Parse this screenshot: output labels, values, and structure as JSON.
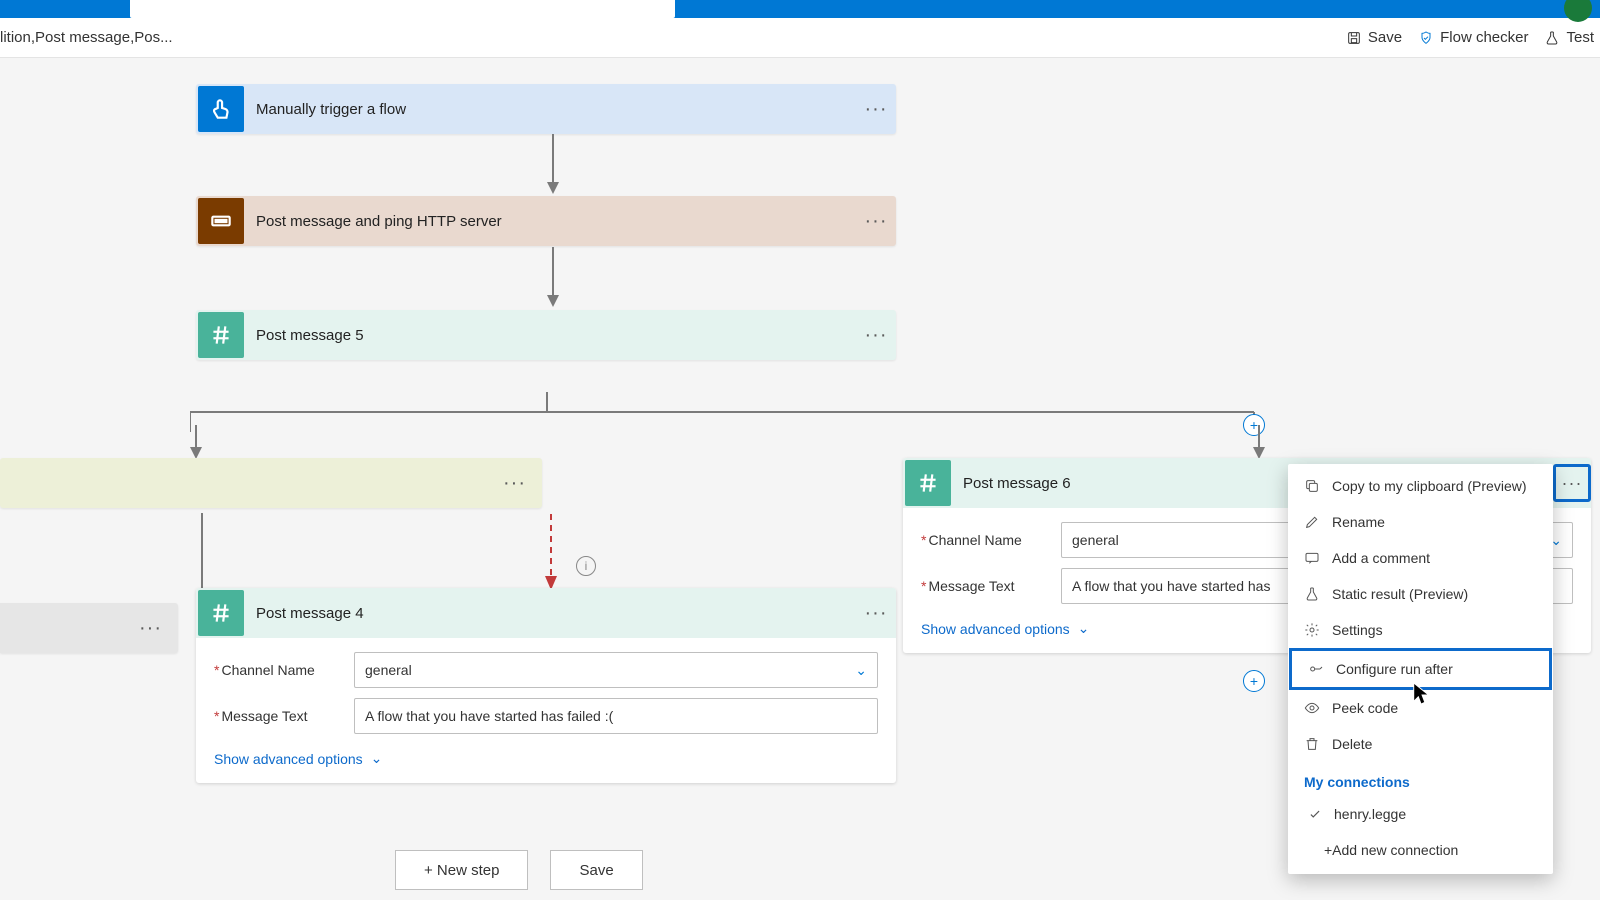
{
  "breadcrumb": "lition,Post message,Pos...",
  "toolbar": {
    "save": "Save",
    "flow_checker": "Flow checker",
    "test": "Test"
  },
  "steps": {
    "trigger": "Manually trigger a flow",
    "scope": "Post message and ping HTTP server",
    "slack5": "Post message 5",
    "pm4": {
      "title": "Post message 4",
      "channel_label": "Channel Name",
      "channel_value": "general",
      "msg_label": "Message Text",
      "msg_value": "A flow that you have started has failed :(",
      "advanced": "Show advanced options"
    },
    "pm6": {
      "title": "Post message 6",
      "channel_label": "Channel Name",
      "channel_value": "general",
      "msg_label": "Message Text",
      "msg_value": "A flow that you have started has",
      "advanced": "Show advanced options"
    }
  },
  "buttons": {
    "new_step": "+ New step",
    "save": "Save"
  },
  "menu": {
    "copy": "Copy to my clipboard (Preview)",
    "rename": "Rename",
    "comment": "Add a comment",
    "static": "Static result (Preview)",
    "settings": "Settings",
    "configure": "Configure run after",
    "peek": "Peek code",
    "delete": "Delete",
    "connections_hdr": "My connections",
    "conn1": "henry.legge",
    "add_conn": "+Add new connection"
  }
}
